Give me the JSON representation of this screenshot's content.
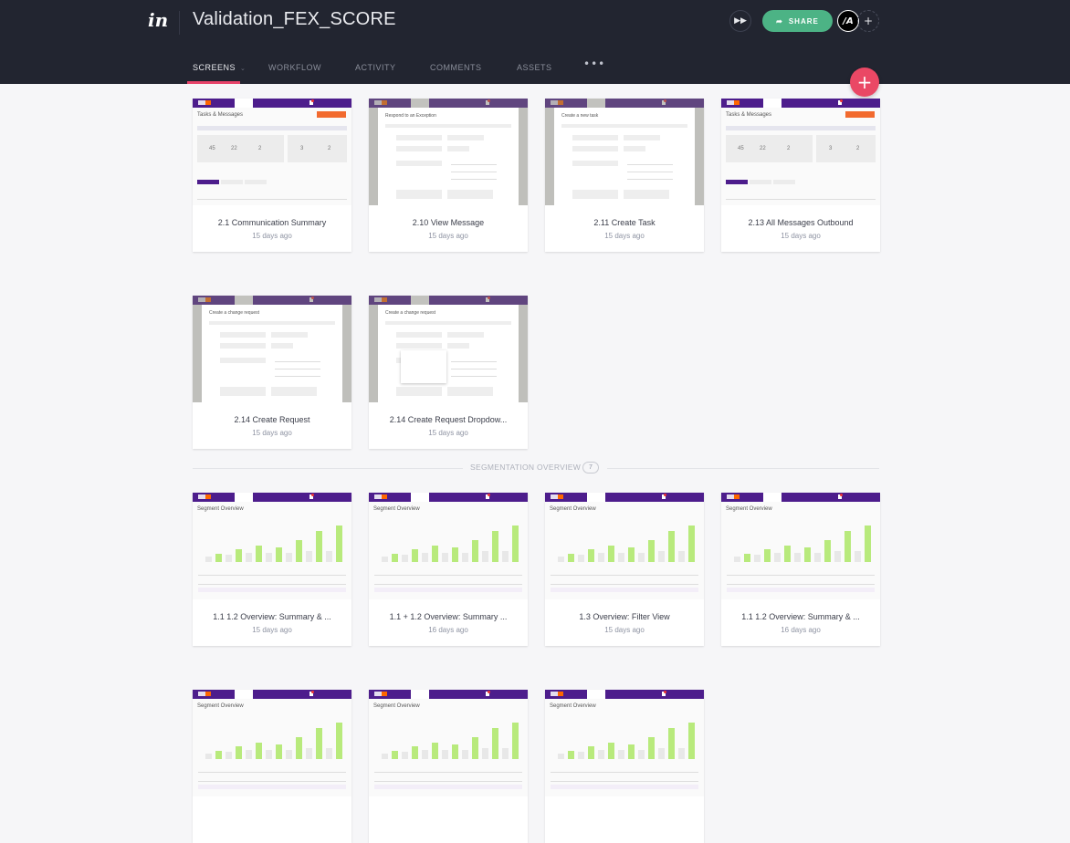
{
  "app": {
    "logo": "in",
    "project_title": "Validation_FEX_SCORE"
  },
  "nav": {
    "tabs": [
      {
        "label": "SCREENS",
        "active": true,
        "has_dropdown": true
      },
      {
        "label": "WORKFLOW",
        "active": false
      },
      {
        "label": "ACTIVITY",
        "active": false
      },
      {
        "label": "COMMENTS",
        "active": false
      },
      {
        "label": "ASSETS",
        "active": false
      }
    ],
    "more_label": "•••"
  },
  "header_actions": {
    "preview_icon": "fast-forward-icon",
    "share_label": "SHARE",
    "share_icon": "share-arrow-icon",
    "avatar_initials": "/A",
    "add_member_icon": "plus-icon",
    "fab_icon": "plus-icon"
  },
  "colors": {
    "header_bg": "#222530",
    "accent_pink": "#ea4865",
    "share_green": "#4cb385",
    "thumb_purple": "#4d1d8c",
    "thumb_orange": "#f26a2e",
    "bar_green": "#b8ea7c"
  },
  "screens_group1": [
    {
      "title": "2.1 Communication Summary",
      "date": "15 days ago",
      "thumb": "tasks",
      "thumb_heading": "Tasks & Messages",
      "stats": [
        "45",
        "22",
        "2",
        "3",
        "2"
      ]
    },
    {
      "title": "2.10 View Message",
      "date": "15 days ago",
      "thumb": "modal",
      "thumb_heading": "Respond to an Exception"
    },
    {
      "title": "2.11 Create Task",
      "date": "15 days ago",
      "thumb": "modal",
      "thumb_heading": "Create a new task"
    },
    {
      "title": "2.13 All Messages Outbound",
      "date": "15 days ago",
      "thumb": "tasks",
      "thumb_heading": "Tasks & Messages",
      "stats": [
        "45",
        "22",
        "2",
        "3",
        "2"
      ]
    },
    {
      "title": "2.14 Create Request",
      "date": "15 days ago",
      "thumb": "modal",
      "thumb_heading": "Create a change request"
    },
    {
      "title": "2.14 Create Request Dropdow...",
      "date": "15 days ago",
      "thumb": "modal-dropdown",
      "thumb_heading": "Create a change request"
    }
  ],
  "section": {
    "label": "SEGMENTATION OVERVIEW",
    "count": "7"
  },
  "screens_group2": [
    {
      "title": "1.1 1.2 Overview: Summary & ...",
      "date": "15 days ago",
      "thumb": "segment",
      "thumb_heading": "Segment Overview"
    },
    {
      "title": "1.1 + 1.2 Overview: Summary ...",
      "date": "16 days ago",
      "thumb": "segment",
      "thumb_heading": "Segment Overview"
    },
    {
      "title": "1.3 Overview: Filter View",
      "date": "15 days ago",
      "thumb": "segment",
      "thumb_heading": "Segment Overview"
    },
    {
      "title": "1.1 1.2 Overview: Summary & ...",
      "date": "16 days ago",
      "thumb": "segment",
      "thumb_heading": "Segment Overview"
    },
    {
      "title": "",
      "date": "",
      "thumb": "segment",
      "thumb_heading": "Segment Overview"
    },
    {
      "title": "",
      "date": "",
      "thumb": "segment",
      "thumb_heading": "Segment Overview"
    },
    {
      "title": "",
      "date": "",
      "thumb": "segment",
      "thumb_heading": "Segment Overview"
    }
  ]
}
